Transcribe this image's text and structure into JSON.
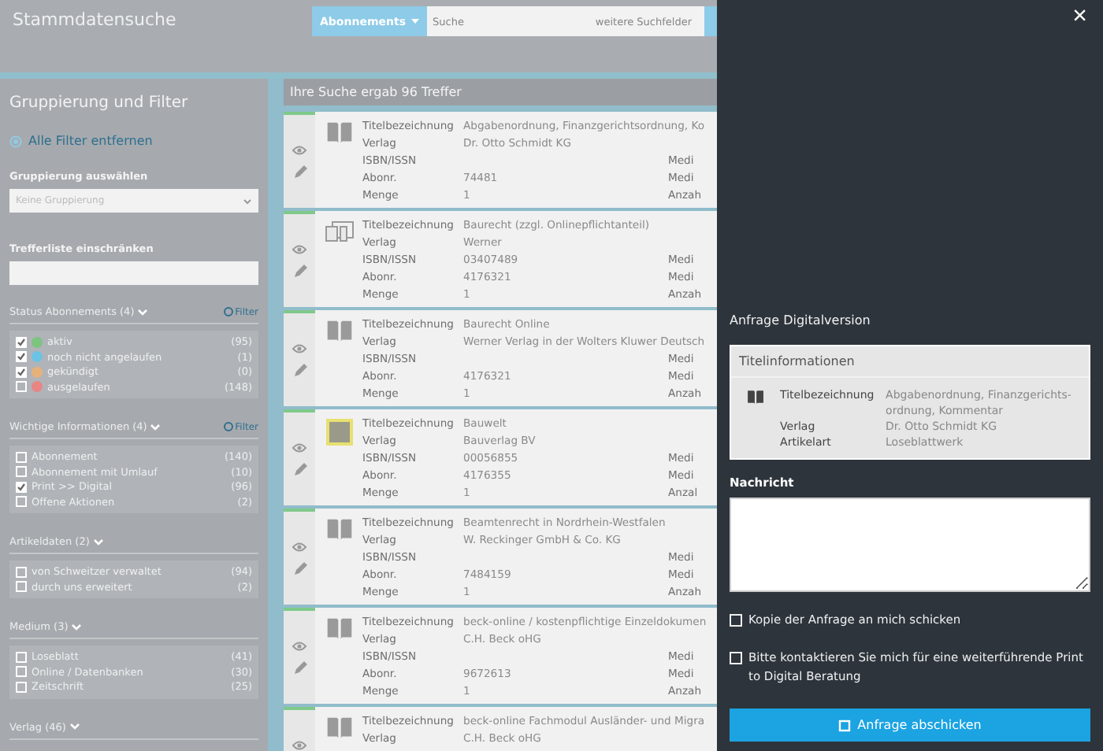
{
  "header": {
    "title": "Stammdatensuche",
    "search": {
      "scope": "Abonnements",
      "placeholder": "Suche",
      "extra": "weitere Suchfelder"
    }
  },
  "sidebar": {
    "title": "Gruppierung und Filter",
    "clear_all": "Alle Filter entfernen",
    "group_label": "Gruppierung auswählen",
    "group_value": "Keine Gruppierung",
    "filter_label": "Trefferliste einschränken",
    "sections": [
      {
        "title": "Status Abonnements (4)",
        "expanded": true,
        "filter_link": "Filter",
        "items": [
          {
            "label": "aktiv",
            "count": "(95)",
            "checked": true,
            "color": "#7cc47f"
          },
          {
            "label": "noch nicht angelaufen",
            "count": "(1)",
            "checked": true,
            "color": "#6cc3e6"
          },
          {
            "label": "gekündigt",
            "count": "(0)",
            "checked": true,
            "color": "#e6b27a"
          },
          {
            "label": "ausgelaufen",
            "count": "(148)",
            "checked": false,
            "color": "#e88585"
          }
        ]
      },
      {
        "title": "Wichtige Informationen (4)",
        "expanded": true,
        "filter_link": "Filter",
        "items": [
          {
            "label": "Abonnement",
            "count": "(140)",
            "checked": false
          },
          {
            "label": "Abonnement mit Umlauf",
            "count": "(10)",
            "checked": false
          },
          {
            "label": "Print >> Digital",
            "count": "(96)",
            "checked": true
          },
          {
            "label": "Offene Aktionen",
            "count": "(2)",
            "checked": false
          }
        ]
      },
      {
        "title": "Artikeldaten (2)",
        "expanded": true,
        "items": [
          {
            "label": "von Schweitzer verwaltet",
            "count": "(94)",
            "checked": false
          },
          {
            "label": "durch uns erweitert",
            "count": "(2)",
            "checked": false
          }
        ]
      },
      {
        "title": "Medium (3)",
        "expanded": true,
        "items": [
          {
            "label": "Loseblatt",
            "count": "(41)",
            "checked": false
          },
          {
            "label": "Online / Datenbanken",
            "count": "(30)",
            "checked": false
          },
          {
            "label": "Zeitschrift",
            "count": "(25)",
            "checked": false
          }
        ]
      },
      {
        "title": "Verlag (46)",
        "expanded": true
      }
    ]
  },
  "results": {
    "summary": "Ihre Suche ergab 96 Treffer",
    "cards": [
      {
        "kind": "book",
        "rows": [
          {
            "label": "Titelbezeichnung",
            "value": "Abgabenordnung, Finanzgerichtsordnung, Ko"
          },
          {
            "label": "Verlag",
            "value": "Dr. Otto Schmidt KG"
          },
          {
            "label": "ISBN/ISSN",
            "side": "Medi"
          },
          {
            "label": "Abonr.",
            "value": "74481",
            "side": "Medi"
          },
          {
            "label": "Menge",
            "value": "1",
            "side": "Anzah"
          }
        ]
      },
      {
        "kind": "devices",
        "rows": [
          {
            "label": "Titelbezeichnung",
            "value": "Baurecht (zzgl. Onlinepflichtanteil)"
          },
          {
            "label": "Verlag",
            "value": "Werner"
          },
          {
            "label": "ISBN/ISSN",
            "value": "03407489",
            "side": "Medi"
          },
          {
            "label": "Abonr.",
            "value": "4176321",
            "side": "Medi"
          },
          {
            "label": "Menge",
            "value": "1",
            "side": "Anzah"
          }
        ]
      },
      {
        "kind": "book",
        "rows": [
          {
            "label": "Titelbezeichnung",
            "value": "Baurecht Online"
          },
          {
            "label": "Verlag",
            "value": "Werner Verlag in der Wolters Kluwer Deutsch"
          },
          {
            "label": "ISBN/ISSN",
            "side": "Medi"
          },
          {
            "label": "Abonr.",
            "value": "4176321",
            "side": "Medi"
          },
          {
            "label": "Menge",
            "value": "1",
            "side": "Anzah"
          }
        ]
      },
      {
        "kind": "cover",
        "rows": [
          {
            "label": "Titelbezeichnung",
            "value": "Bauwelt"
          },
          {
            "label": "Verlag",
            "value": "Bauverlag BV"
          },
          {
            "label": "ISBN/ISSN",
            "value": "00056855",
            "side": "Medi"
          },
          {
            "label": "Abonr.",
            "value": "4176355",
            "side": "Medi"
          },
          {
            "label": "Menge",
            "value": "1",
            "side": "Anzal"
          }
        ]
      },
      {
        "kind": "book",
        "rows": [
          {
            "label": "Titelbezeichnung",
            "value": "Beamtenrecht in Nordrhein-Westfalen"
          },
          {
            "label": "Verlag",
            "value": "W. Reckinger GmbH & Co. KG"
          },
          {
            "label": "ISBN/ISSN",
            "side": "Medi"
          },
          {
            "label": "Abonr.",
            "value": "7484159",
            "side": "Medi"
          },
          {
            "label": "Menge",
            "value": "1",
            "side": "Anzah"
          }
        ]
      },
      {
        "kind": "book",
        "rows": [
          {
            "label": "Titelbezeichnung",
            "value": "beck-online / kostenpflichtige Einzeldokumen"
          },
          {
            "label": "Verlag",
            "value": "C.H. Beck oHG"
          },
          {
            "label": "ISBN/ISSN",
            "side": "Medi"
          },
          {
            "label": "Abonr.",
            "value": "9672613",
            "side": "Medi"
          },
          {
            "label": "Menge",
            "value": "1",
            "side": "Anzah"
          }
        ]
      },
      {
        "kind": "book",
        "rows": [
          {
            "label": "Titelbezeichnung",
            "value": "beck-online Fachmodul Ausländer- und Migra"
          },
          {
            "label": "Verlag",
            "value": "C.H. Beck oHG"
          }
        ]
      }
    ]
  },
  "drawer": {
    "close": "×",
    "heading": "Anfrage Digitalversion",
    "info_title": "Titelinformationen",
    "info_rows": [
      {
        "label": "Titelbezeichnung",
        "value": "Abgabenordnung, Finanzgerichts-ordnung, Kommentar"
      },
      {
        "label": "Verlag",
        "value": "Dr. Otto Schmidt KG"
      },
      {
        "label": "Artikelart",
        "value": "Loseblattwerk"
      }
    ],
    "message_label": "Nachricht",
    "options": [
      {
        "label": "Kopie der Anfrage an mich schicken",
        "checked": false
      },
      {
        "label": "Bitte kontaktieren Sie mich für eine weiterführende Print to Digital Beratung",
        "checked": false
      }
    ],
    "submit": "Anfrage abschicken"
  }
}
